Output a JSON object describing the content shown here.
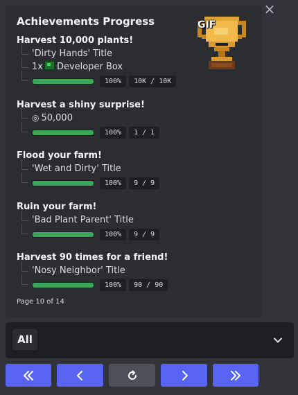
{
  "card": {
    "title": "Achievements Progress",
    "gif_label": "GIF",
    "achievements": [
      {
        "title": "Harvest 10,000 plants!",
        "rewards": [
          "'Dirty Hands' Title"
        ],
        "item_reward": {
          "qty": "1x",
          "name": "Developer Box"
        },
        "progress_fraction": 1.0,
        "percent": "100%",
        "count": "10K / 10K"
      },
      {
        "title": "Harvest a shiny surprise!",
        "coin_reward": "50,000",
        "progress_fraction": 1.0,
        "percent": "100%",
        "count": "1 / 1"
      },
      {
        "title": "Flood your farm!",
        "rewards": [
          "'Wet and Dirty' Title"
        ],
        "progress_fraction": 1.0,
        "percent": "100%",
        "count": "9 / 9"
      },
      {
        "title": "Ruin your farm!",
        "rewards": [
          "'Bad Plant Parent' Title"
        ],
        "progress_fraction": 1.0,
        "percent": "100%",
        "count": "9 / 9"
      },
      {
        "title": "Harvest 90 times for a friend!",
        "rewards": [
          "'Nosy Neighbor' Title"
        ],
        "progress_fraction": 1.0,
        "percent": "100%",
        "count": "90 / 90"
      }
    ],
    "page_label": "Page 10 of 14"
  },
  "filter_select": {
    "value": "All"
  },
  "pagination": {
    "buttons": [
      "first-page",
      "previous-page",
      "refresh",
      "next-page",
      "last-page"
    ]
  },
  "colors": {
    "background": "#313338",
    "card": "#2b2d31",
    "progress": "#3ba55c",
    "primary_button": "#5865f2",
    "secondary_button": "#4e5058"
  },
  "icons": {
    "close": "close-icon",
    "trophy": "trophy-icon",
    "developer_box": "developer-box-icon",
    "coin": "coin-icon",
    "chevron": "chevron-down-icon"
  }
}
